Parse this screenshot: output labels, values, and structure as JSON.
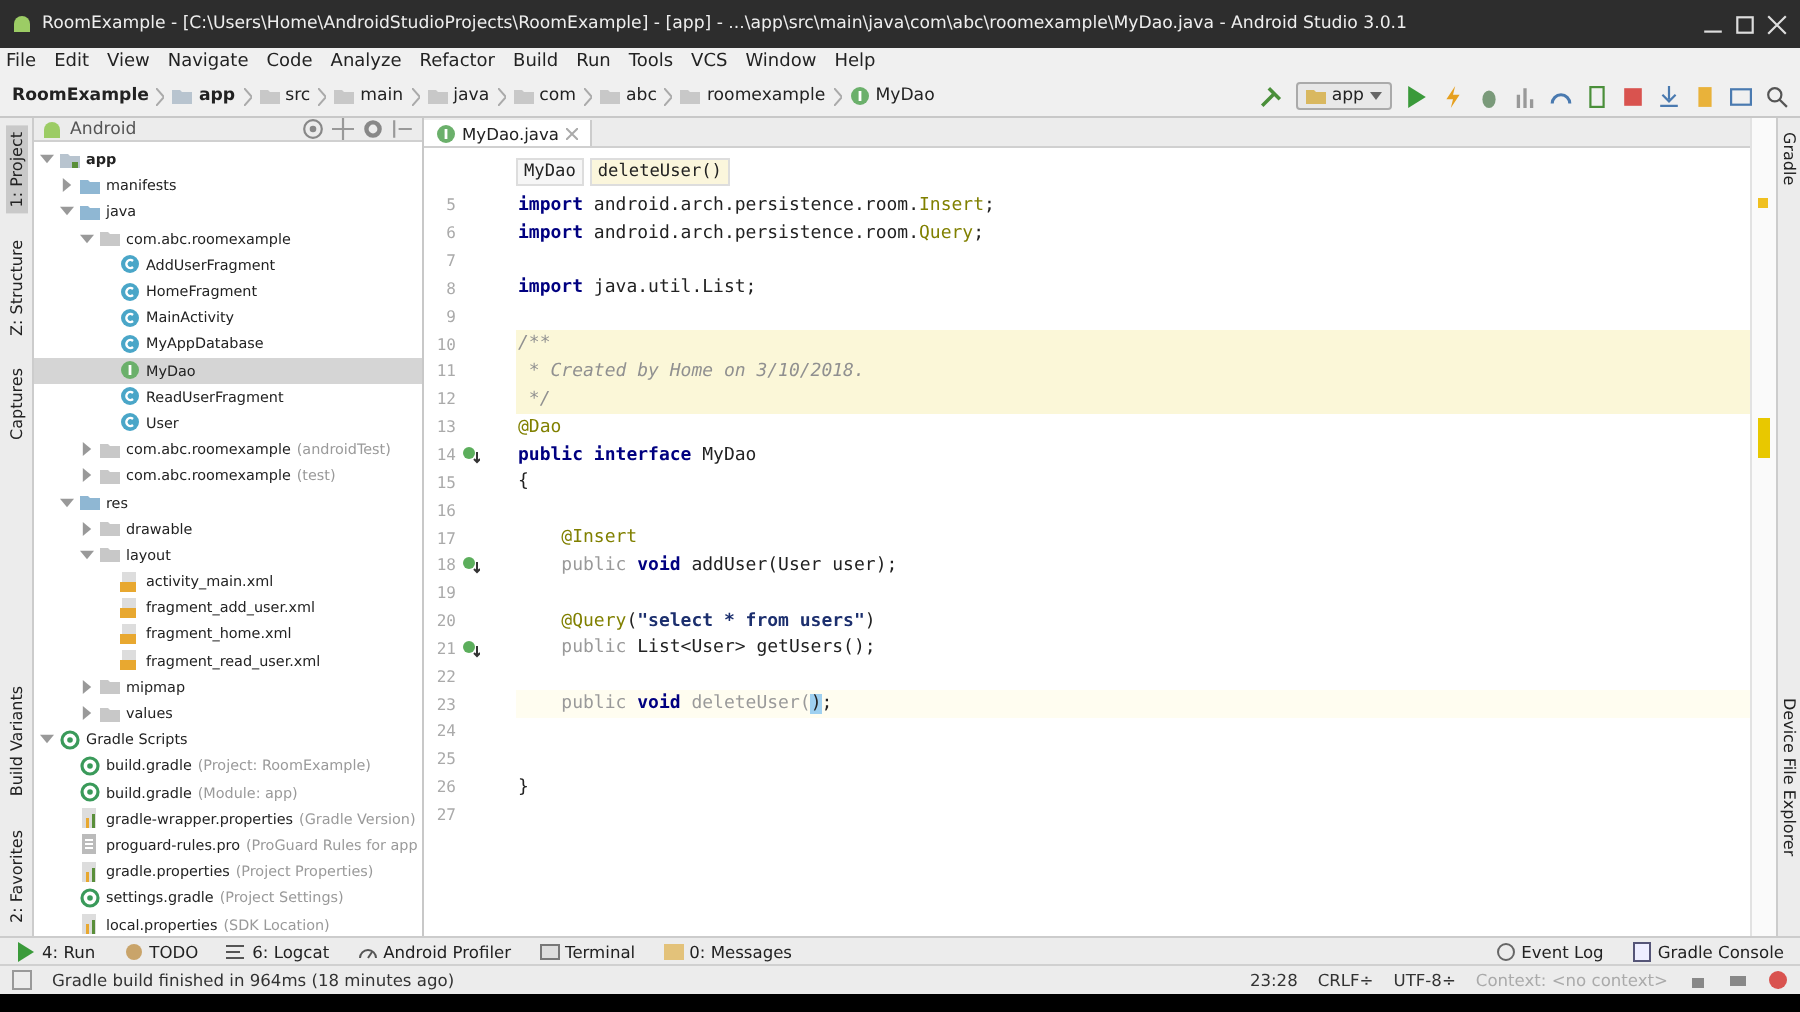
{
  "window": {
    "title": "RoomExample - [C:\\Users\\Home\\AndroidStudioProjects\\RoomExample] - [app] - ...\\app\\src\\main\\java\\com\\abc\\roomexample\\MyDao.java - Android Studio 3.0.1"
  },
  "menu": [
    "File",
    "Edit",
    "View",
    "Navigate",
    "Code",
    "Analyze",
    "Refactor",
    "Build",
    "Run",
    "Tools",
    "VCS",
    "Window",
    "Help"
  ],
  "breadcrumbs": [
    {
      "label": "RoomExample",
      "kind": "project"
    },
    {
      "label": "app",
      "kind": "module"
    },
    {
      "label": "src",
      "kind": "folder"
    },
    {
      "label": "main",
      "kind": "folder"
    },
    {
      "label": "java",
      "kind": "folder"
    },
    {
      "label": "com",
      "kind": "folder"
    },
    {
      "label": "abc",
      "kind": "folder"
    },
    {
      "label": "roomexample",
      "kind": "folder"
    },
    {
      "label": "MyDao",
      "kind": "interface"
    }
  ],
  "run_config": {
    "label": "app"
  },
  "left_strip": {
    "top": [
      {
        "label": "1: Project",
        "selected": true
      },
      {
        "label": "Z: Structure",
        "selected": false
      },
      {
        "label": "Captures",
        "selected": false
      }
    ],
    "bottom": [
      {
        "label": "Build Variants",
        "selected": false
      },
      {
        "label": "2: Favorites",
        "selected": false
      }
    ]
  },
  "project_panel": {
    "view": "Android",
    "tree": [
      {
        "label": "app",
        "kind": "module",
        "expanded": true,
        "selected": false,
        "children": [
          {
            "label": "manifests",
            "kind": "folder",
            "expanded": false,
            "selected": false
          },
          {
            "label": "java",
            "kind": "folder",
            "expanded": true,
            "selected": false,
            "children": [
              {
                "label": "com.abc.roomexample",
                "kind": "package",
                "expanded": true,
                "selected": false,
                "children": [
                  {
                    "label": "AddUserFragment",
                    "kind": "class",
                    "selected": false
                  },
                  {
                    "label": "HomeFragment",
                    "kind": "class",
                    "selected": false
                  },
                  {
                    "label": "MainActivity",
                    "kind": "class",
                    "selected": false
                  },
                  {
                    "label": "MyAppDatabase",
                    "kind": "class",
                    "selected": false
                  },
                  {
                    "label": "MyDao",
                    "kind": "interface",
                    "selected": true
                  },
                  {
                    "label": "ReadUserFragment",
                    "kind": "class",
                    "selected": false
                  },
                  {
                    "label": "User",
                    "kind": "class",
                    "selected": false
                  }
                ]
              },
              {
                "label": "com.abc.roomexample",
                "note": "(androidTest)",
                "kind": "package",
                "expanded": false,
                "selected": false
              },
              {
                "label": "com.abc.roomexample",
                "note": "(test)",
                "kind": "package",
                "expanded": false,
                "selected": false
              }
            ]
          },
          {
            "label": "res",
            "kind": "folder",
            "expanded": true,
            "selected": false,
            "children": [
              {
                "label": "drawable",
                "kind": "package",
                "expanded": false,
                "selected": false
              },
              {
                "label": "layout",
                "kind": "package",
                "expanded": true,
                "selected": false,
                "children": [
                  {
                    "label": "activity_main.xml",
                    "kind": "xml",
                    "selected": false
                  },
                  {
                    "label": "fragment_add_user.xml",
                    "kind": "xml",
                    "selected": false
                  },
                  {
                    "label": "fragment_home.xml",
                    "kind": "xml",
                    "selected": false
                  },
                  {
                    "label": "fragment_read_user.xml",
                    "kind": "xml",
                    "selected": false
                  }
                ]
              },
              {
                "label": "mipmap",
                "kind": "package",
                "expanded": false,
                "selected": false
              },
              {
                "label": "values",
                "kind": "package",
                "expanded": false,
                "selected": false
              }
            ]
          }
        ]
      },
      {
        "label": "Gradle Scripts",
        "kind": "gradle",
        "expanded": true,
        "selected": false,
        "children": [
          {
            "label": "build.gradle",
            "note": "(Project: RoomExample)",
            "kind": "gradle",
            "selected": false
          },
          {
            "label": "build.gradle",
            "note": "(Module: app)",
            "kind": "gradle",
            "selected": false
          },
          {
            "label": "gradle-wrapper.properties",
            "note": "(Gradle Version)",
            "kind": "properties",
            "selected": false
          },
          {
            "label": "proguard-rules.pro",
            "note": "(ProGuard Rules for app",
            "kind": "text",
            "selected": false
          },
          {
            "label": "gradle.properties",
            "note": "(Project Properties)",
            "kind": "properties",
            "selected": false
          },
          {
            "label": "settings.gradle",
            "note": "(Project Settings)",
            "kind": "gradle",
            "selected": false
          },
          {
            "label": "local.properties",
            "note": "(SDK Location)",
            "kind": "properties",
            "selected": false
          }
        ]
      }
    ]
  },
  "editor": {
    "tabs": [
      {
        "label": "MyDao.java",
        "selected": true
      }
    ],
    "crumbs": [
      "MyDao",
      "deleteUser()"
    ],
    "lines": [
      {
        "number": "5",
        "tokens": [
          {
            "text": "import",
            "kind": "keyword"
          },
          {
            "text": " android.arch.persistence.room.",
            "kind": "plain"
          },
          {
            "text": "Insert",
            "kind": "annotation"
          },
          {
            "text": ";",
            "kind": "plain"
          }
        ]
      },
      {
        "number": "6",
        "tokens": [
          {
            "text": "import",
            "kind": "keyword"
          },
          {
            "text": " android.arch.persistence.room.",
            "kind": "plain"
          },
          {
            "text": "Query",
            "kind": "annotation"
          },
          {
            "text": ";",
            "kind": "plain"
          }
        ]
      },
      {
        "number": "7"
      },
      {
        "number": "8",
        "tokens": [
          {
            "text": "import",
            "kind": "keyword"
          },
          {
            "text": " java.util.List;",
            "kind": "plain"
          }
        ]
      },
      {
        "number": "9"
      },
      {
        "number": "10",
        "doc_comment": true,
        "tokens": [
          {
            "text": "/**",
            "kind": "comment"
          }
        ]
      },
      {
        "number": "11",
        "doc_comment": true,
        "tokens": [
          {
            "text": " * Created by Home on 3/10/2018.",
            "kind": "comment"
          }
        ]
      },
      {
        "number": "12",
        "doc_comment": true,
        "tokens": [
          {
            "text": " */",
            "kind": "comment"
          }
        ]
      },
      {
        "number": "13",
        "tokens": [
          {
            "text": "@Dao",
            "kind": "annotation"
          }
        ]
      },
      {
        "number": "14",
        "implemented_marker": true,
        "tokens": [
          {
            "text": "public",
            "kind": "keyword"
          },
          {
            "text": " interface",
            "kind": "keyword"
          },
          {
            "text": " MyDao",
            "kind": "plain"
          }
        ]
      },
      {
        "number": "15",
        "tokens": [
          {
            "text": "{",
            "kind": "plain"
          }
        ]
      },
      {
        "number": "16"
      },
      {
        "number": "17",
        "tokens": [
          {
            "text": "    @Insert",
            "kind": "annotation"
          }
        ]
      },
      {
        "number": "18",
        "implemented_marker": true,
        "tokens": [
          {
            "text": "    public",
            "kind": "unused"
          },
          {
            "text": " void",
            "kind": "keyword"
          },
          {
            "text": " addUser(User user);",
            "kind": "plain"
          }
        ]
      },
      {
        "number": "19"
      },
      {
        "number": "20",
        "tokens": [
          {
            "text": "    @Query",
            "kind": "annotation"
          },
          {
            "text": "(",
            "kind": "plain"
          },
          {
            "text": "\"select * from users\"",
            "kind": "string"
          },
          {
            "text": ")",
            "kind": "plain"
          }
        ]
      },
      {
        "number": "21",
        "implemented_marker": true,
        "tokens": [
          {
            "text": "    public",
            "kind": "unused"
          },
          {
            "text": " List<User> getUsers();",
            "kind": "plain"
          }
        ]
      },
      {
        "number": "22"
      },
      {
        "number": "23",
        "current_line": true,
        "tokens": [
          {
            "text": "    public",
            "kind": "unused"
          },
          {
            "text": " void",
            "kind": "keyword"
          },
          {
            "text": " deleteUser(",
            "kind": "unused"
          },
          {
            "text": ")",
            "kind": "matched"
          },
          {
            "text": ";",
            "kind": "plain"
          }
        ]
      },
      {
        "number": "24"
      },
      {
        "number": "25"
      },
      {
        "number": "26",
        "tokens": [
          {
            "text": "}",
            "kind": "plain"
          }
        ]
      },
      {
        "number": "27"
      }
    ]
  },
  "right_strip": [
    "Gradle",
    "Device File Explorer"
  ],
  "bottom_tools": {
    "left": [
      {
        "label": "4: Run",
        "kind": "run"
      },
      {
        "label": "TODO",
        "kind": "todo"
      },
      {
        "label": "6: Logcat",
        "kind": "logcat"
      },
      {
        "label": "Android Profiler",
        "kind": "profiler"
      },
      {
        "label": "Terminal",
        "kind": "terminal"
      },
      {
        "label": "0: Messages",
        "kind": "messages"
      }
    ],
    "right": [
      {
        "label": "Event Log",
        "kind": "log"
      },
      {
        "label": "Gradle Console",
        "kind": "console"
      }
    ]
  },
  "status_bar": {
    "message": "Gradle build finished in 964ms (18 minutes ago)",
    "position": "23:28",
    "line_sep": "CRLF÷",
    "encoding": "UTF-8÷",
    "context": "Context: <no context>"
  }
}
